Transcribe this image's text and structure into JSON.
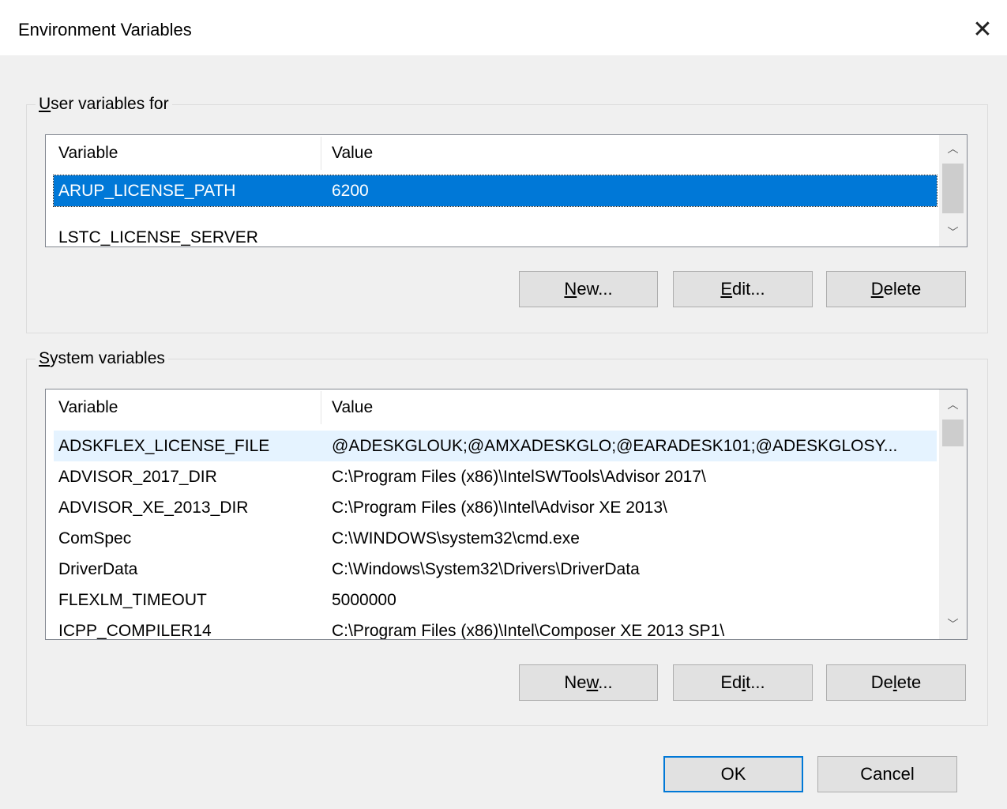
{
  "window": {
    "title": "Environment Variables"
  },
  "user_vars": {
    "label": "User variables for ",
    "label_mnemonic": "U",
    "label_rest": "ser variables for ",
    "headers": {
      "variable": "Variable",
      "value": "Value"
    },
    "rows": [
      {
        "variable": "ARUP_LICENSE_PATH",
        "value": "6200",
        "selected": true
      },
      {
        "variable": "LSTC_LICENSE_SERVER",
        "value": ""
      }
    ],
    "buttons": {
      "new": {
        "pre": "",
        "key": "N",
        "post": "ew..."
      },
      "edit": {
        "pre": "",
        "key": "E",
        "post": "dit..."
      },
      "delete": {
        "pre": "",
        "key": "D",
        "post": "elete"
      }
    }
  },
  "system_vars": {
    "label_mnemonic": "S",
    "label_rest": "ystem variables",
    "headers": {
      "variable": "Variable",
      "value": "Value"
    },
    "rows": [
      {
        "variable": "ADSKFLEX_LICENSE_FILE",
        "value": "@ADESKGLOUK;@AMXADESKGLO;@EARADESK101;@ADESKGLOSY..."
      },
      {
        "variable": "ADVISOR_2017_DIR",
        "value": "C:\\Program Files (x86)\\IntelSWTools\\Advisor 2017\\"
      },
      {
        "variable": "ADVISOR_XE_2013_DIR",
        "value": "C:\\Program Files (x86)\\Intel\\Advisor XE 2013\\"
      },
      {
        "variable": "ComSpec",
        "value": "C:\\WINDOWS\\system32\\cmd.exe"
      },
      {
        "variable": "DriverData",
        "value": "C:\\Windows\\System32\\Drivers\\DriverData"
      },
      {
        "variable": "FLEXLM_TIMEOUT",
        "value": "5000000"
      },
      {
        "variable": "ICPP_COMPILER14",
        "value": "C:\\Program Files (x86)\\Intel\\Composer XE 2013 SP1\\"
      }
    ],
    "buttons": {
      "new": {
        "pre": "Ne",
        "key": "w",
        "post": "..."
      },
      "edit": {
        "pre": "Ed",
        "key": "i",
        "post": "t..."
      },
      "delete": {
        "pre": "De",
        "key": "l",
        "post": "ete"
      }
    }
  },
  "footer": {
    "ok": "OK",
    "cancel": "Cancel"
  },
  "icons": {
    "close": "close-icon",
    "scroll_up": "chevron-up-icon",
    "scroll_down": "chevron-down-icon"
  },
  "colors": {
    "selection": "#0078d7",
    "hover_row": "#e5f3ff",
    "default_button_border": "#0078d7"
  }
}
